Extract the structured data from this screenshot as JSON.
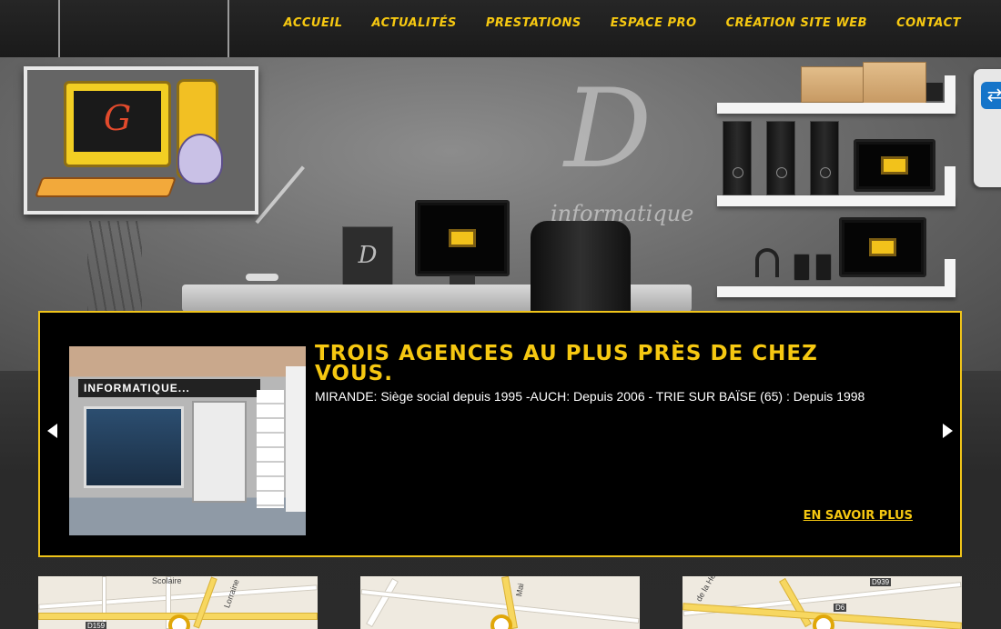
{
  "nav": {
    "items": [
      "ACCUEIL",
      "ACTUALITÉS",
      "PRESTATIONS",
      "ESPACE PRO",
      "CRÉATION SITE WEB",
      "CONTACT"
    ]
  },
  "hero": {
    "brand_sub": "informatique",
    "deskbox_mark": "D",
    "logo_mark": "G"
  },
  "slider": {
    "title": "TROIS AGENCES AU PLUS PRÈS DE CHEZ VOUS.",
    "text": "MIRANDE: Siège social depuis 1995 -AUCH: Depuis 2006 - TRIE SUR BAÏSE (65) : Depuis 1998",
    "more": "EN SAVOIR PLUS",
    "shop_banner": "INFORMATIQUE..."
  },
  "maps": [
    {
      "label1": "Scolaire",
      "label2": "Lorraine",
      "road": "D159"
    },
    {
      "label1": "Mai",
      "label2": "",
      "road": ""
    },
    {
      "label1": "de la Her",
      "label2": "",
      "road": "D939",
      "road2": "D6"
    }
  ],
  "colors": {
    "accent": "#f6c811",
    "nav_bg": "#1e1e1e",
    "slider_bg": "#000000"
  }
}
